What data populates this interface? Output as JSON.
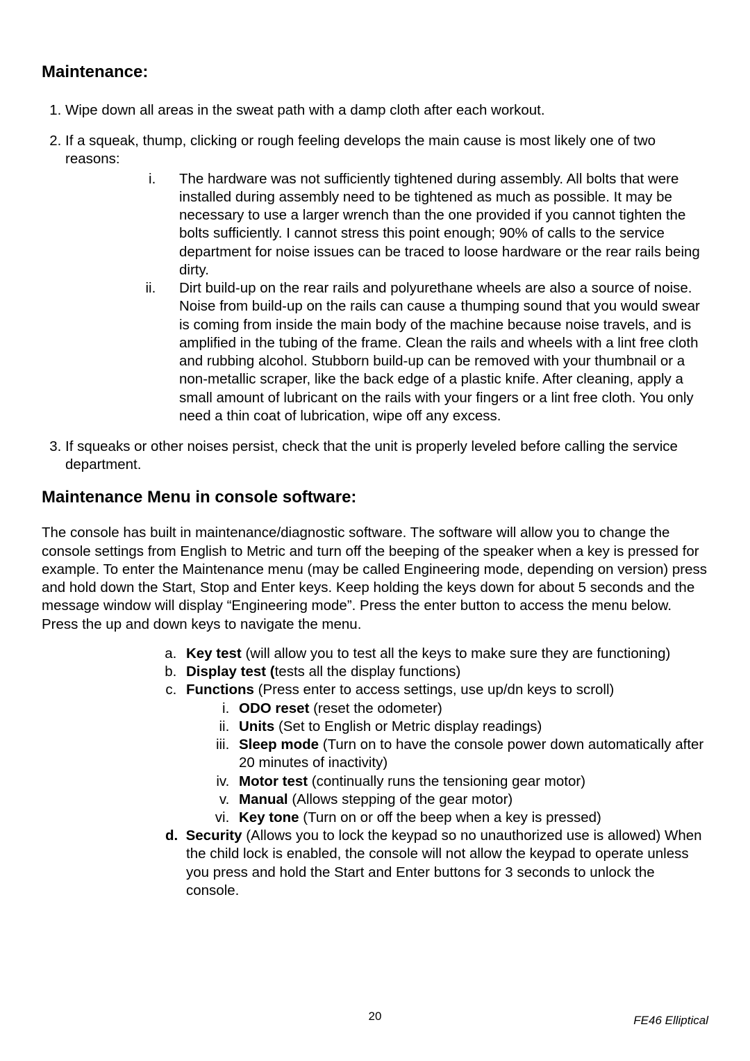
{
  "maintenance": {
    "heading": "Maintenance:",
    "item1": "Wipe down all areas in the sweat path with a damp cloth after each workout.",
    "item2_intro": "If a squeak, thump, clicking or rough feeling develops the main cause is most likely one of two reasons:",
    "item2_i": "The hardware was not sufficiently tightened during assembly. All bolts that were installed during assembly need to be tightened as much as possible. It may be necessary to use a larger wrench than the one provided if you cannot tighten the bolts sufficiently. I cannot stress this point enough; 90% of calls to the service department for noise issues can be traced to loose hardware or the rear rails being dirty.",
    "item2_ii": "Dirt build-up on the rear rails and polyurethane wheels are also a source of noise. Noise from build-up on the rails can cause a thumping sound that you would swear is coming from inside the main body of the machine because noise travels, and is amplified in the tubing of the frame. Clean the rails and wheels with a lint free cloth and rubbing alcohol. Stubborn build-up can be removed with your thumbnail or a non-metallic scraper, like the back edge of a plastic knife. After cleaning, apply a small amount of lubricant on the rails with your fingers or a lint free cloth. You only need a thin coat of lubrication, wipe off any excess.",
    "item3": "If squeaks or other noises persist, check that the unit is properly leveled before calling the service department."
  },
  "console": {
    "heading": "Maintenance Menu in console software:",
    "intro": "The console has built in maintenance/diagnostic software. The software will allow you to change the console settings from English to Metric and turn off the beeping of the speaker when a key is pressed for example. To enter the Maintenance menu (may be called Engineering mode, depending on version) press and hold down the Start, Stop and Enter keys. Keep holding the keys down for about 5 seconds and the message window will display “Engineering mode”. Press the enter button to access the menu below. Press the up and down keys to navigate the menu.",
    "a_label": "Key test",
    "a_text": "  (will allow you to test all the keys to make sure they are functioning)",
    "b_label": "Display test (",
    "b_text": "tests all the display functions)",
    "c_label": "Functions",
    "c_text": " (Press enter to access settings, use up/dn keys to scroll)",
    "c_i_label": "ODO reset",
    "c_i_text": " (reset the odometer)",
    "c_ii_label": "Units",
    "c_ii_text": " (Set to English or Metric display readings)",
    "c_iii_label": "Sleep mode",
    "c_iii_text": " (Turn on to have the console power down automatically after 20 minutes of inactivity)",
    "c_iv_label": "Motor test",
    "c_iv_text": " (continually runs the tensioning gear motor)",
    "c_v_label": "Manual",
    "c_v_text": " (Allows stepping of the gear motor)",
    "c_vi_label": "Key tone",
    "c_vi_text": " (Turn on or off the beep when a key is pressed)",
    "d_label": "Security",
    "d_text": " (Allows you to lock the keypad so no unauthorized use is allowed) When the child lock is enabled, the console will not allow the keypad to operate unless you press and hold the Start and Enter buttons for 3 seconds to unlock the console."
  },
  "footer": {
    "page_number": "20",
    "model": "FE46 Elliptical"
  }
}
